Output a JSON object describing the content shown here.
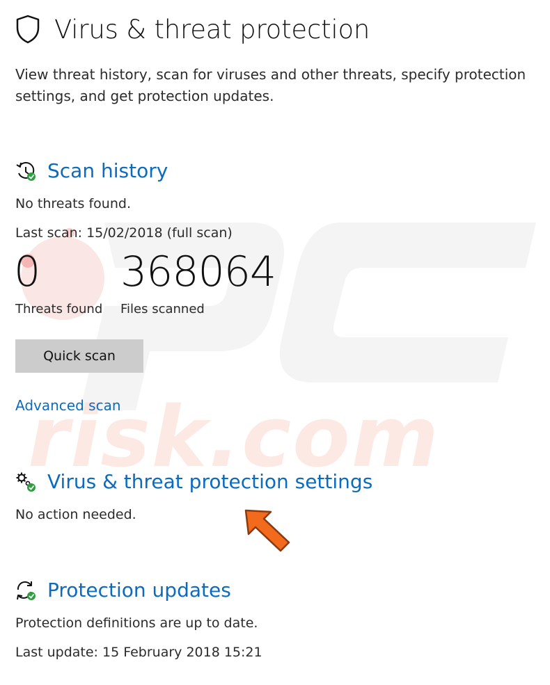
{
  "page": {
    "title": "Virus & threat protection",
    "description": "View threat history, scan for viruses and other threats, specify protection settings, and get protection updates."
  },
  "scan_history": {
    "heading": "Scan history",
    "status": "No threats found.",
    "last_scan": "Last scan: 15/02/2018 (full scan)",
    "threats_found_value": "0",
    "threats_found_label": "Threats found",
    "files_scanned_value": "368064",
    "files_scanned_label": "Files scanned",
    "quick_scan_label": "Quick scan",
    "advanced_scan_label": "Advanced scan"
  },
  "protection_settings": {
    "heading": "Virus & threat protection settings",
    "status": "No action needed."
  },
  "protection_updates": {
    "heading": "Protection updates",
    "status": "Protection definitions are up to date.",
    "last_update": "Last update: 15 February 2018 15:21"
  },
  "watermark": {
    "text": "PCrisk.com"
  },
  "icons": {
    "title": "shield-icon",
    "scan_history": "clock-history-icon",
    "settings": "gears-icon",
    "updates": "refresh-icon",
    "pointer": "arrow-pointer-icon"
  },
  "colors": {
    "link_blue": "#0b6cbf",
    "status_green": "#2e9e3e",
    "button_gray": "#cccccc",
    "arrow_orange": "#f26a1b"
  }
}
